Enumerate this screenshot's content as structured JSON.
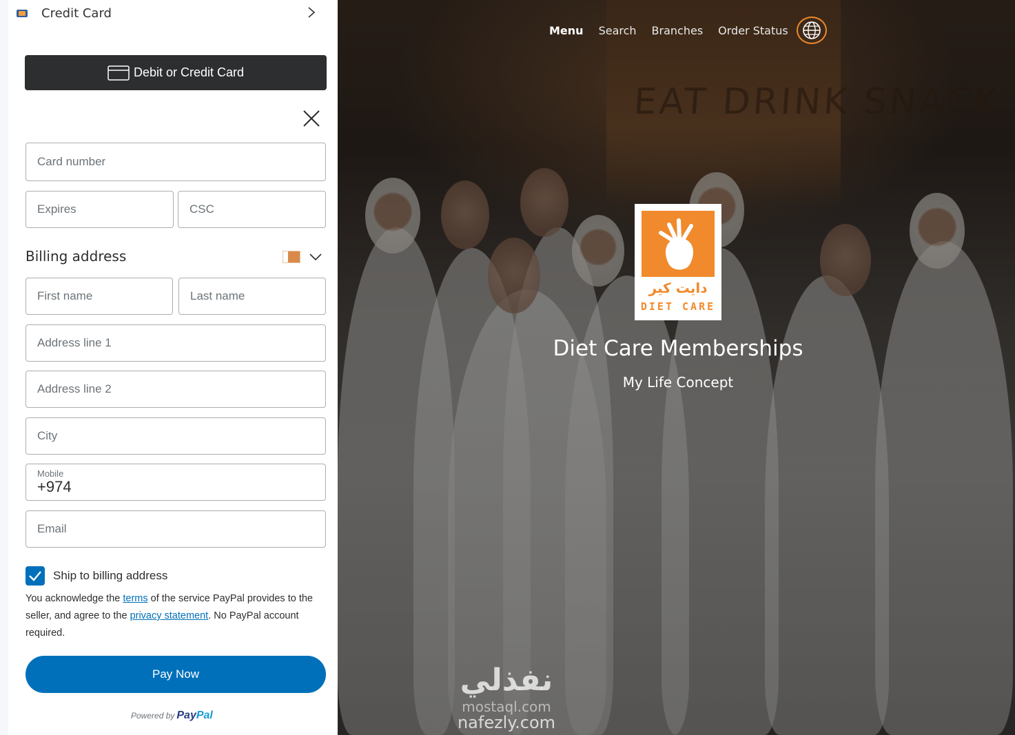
{
  "left_panel": {
    "credit_card_row": {
      "label": "Credit Card"
    },
    "debit_button": {
      "label": "Debit or Credit Card"
    },
    "fields": {
      "card_number": "Card number",
      "expires": "Expires",
      "csc": "CSC",
      "first_name": "First name",
      "last_name": "Last name",
      "address_line_1": "Address line 1",
      "address_line_2": "Address line 2",
      "city": "City",
      "mobile_label": "Mobile",
      "mobile_value": "+974",
      "email": "Email"
    },
    "billing": {
      "title": "Billing address"
    },
    "ship": {
      "label": "Ship to billing address",
      "checked": true
    },
    "legal": {
      "part1": "You acknowledge the ",
      "terms_link": "terms",
      "part2": " of the service PayPal provides to the seller, and agree to the ",
      "privacy_link": "privacy statement",
      "part3": ". No PayPal account required."
    },
    "pay_button": {
      "label": "Pay Now"
    },
    "powered": {
      "text": "Powered by",
      "logo_pay": "Pay",
      "logo_pal": "Pal"
    },
    "colors": {
      "primary_blue": "#0070ba",
      "dark_button": "#2c2e2f"
    }
  },
  "hero": {
    "nav": {
      "items": [
        "Menu",
        "Search",
        "Branches",
        "Order Status"
      ],
      "active": "Menu"
    },
    "logo": {
      "arabic": "دايت كير",
      "latin": "DIET CARE"
    },
    "title": "Diet Care Memberships",
    "subtitle": "My Life Concept",
    "wall_text": "EAT DRINK SNACK",
    "watermark": {
      "arabic": "نفذلي",
      "url1": "mostaql.com",
      "url2": "nafezly.com"
    },
    "colors": {
      "accent": "#f08a2c"
    }
  }
}
